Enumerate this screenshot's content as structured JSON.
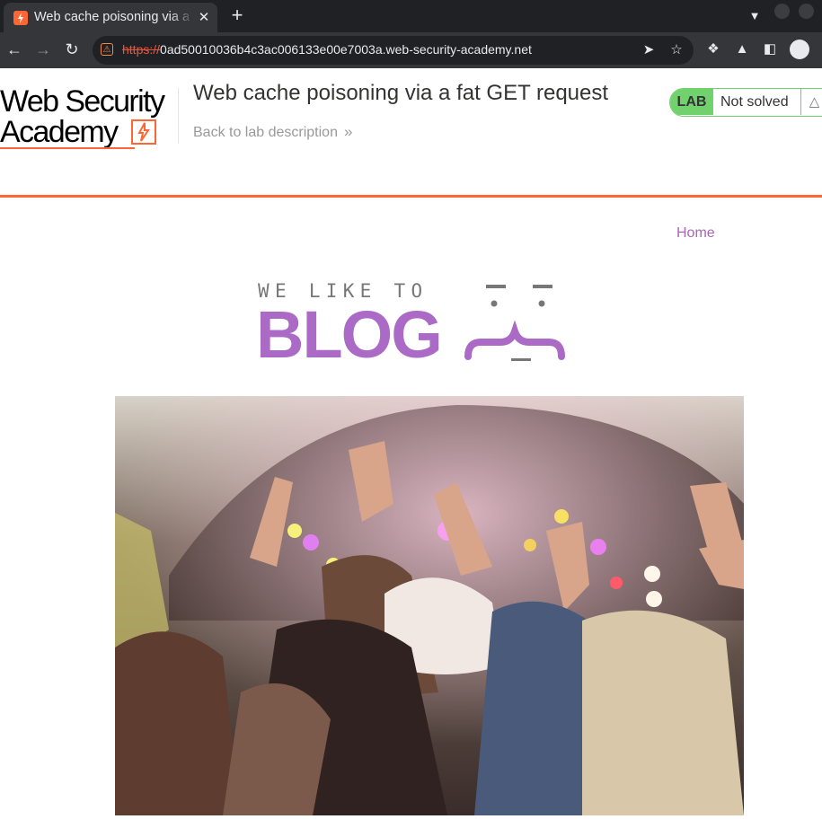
{
  "browser": {
    "tab": {
      "title": "Web cache poisoning via a fat GET request",
      "close_label": "✕"
    },
    "new_tab_label": "+",
    "tab_search_icon": "chevron-down-icon",
    "address_bar": {
      "scheme": "https://",
      "host": "0ad50010036b4c3ac006133e00e7003a.web-security-academy.net"
    }
  },
  "academy": {
    "logo_line1": "Web Security",
    "logo_line2": "Academy",
    "lab_title": "Web cache poisoning via a fat GET request",
    "back_link": "Back to lab description",
    "back_chevron": "»",
    "status_badge": "LAB",
    "status_text": "Not solved",
    "accent_color": "#ff6633",
    "status_color": "#70d16d"
  },
  "blog": {
    "nav": {
      "home": "Home"
    },
    "banner": {
      "tagline": "WE LIKE TO",
      "word": "BLOG"
    },
    "hero_image": "festival-crowd-photo",
    "accent_color": "#aa66b5"
  }
}
